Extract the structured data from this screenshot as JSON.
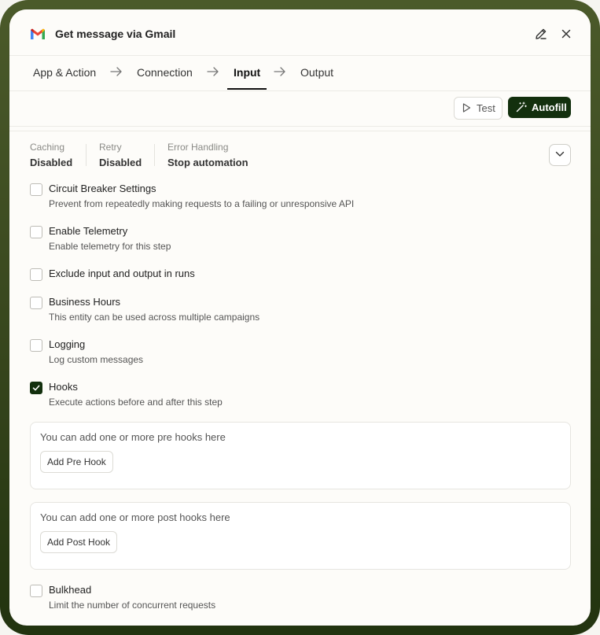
{
  "header": {
    "title": "Get message via Gmail",
    "logo_icon": "gmail-logo",
    "edit_icon": "pencil-icon",
    "close_icon": "close-icon"
  },
  "steps": [
    {
      "label": "App & Action",
      "active": false
    },
    {
      "label": "Connection",
      "active": false
    },
    {
      "label": "Input",
      "active": true
    },
    {
      "label": "Output",
      "active": false
    }
  ],
  "toolbar": {
    "test_label": "Test",
    "autofill_label": "Autofill"
  },
  "summary": {
    "caching_label": "Caching",
    "caching_value": "Disabled",
    "retry_label": "Retry",
    "retry_value": "Disabled",
    "error_label": "Error Handling",
    "error_value": "Stop automation"
  },
  "options": [
    {
      "title": "Circuit Breaker Settings",
      "desc": "Prevent from repeatedly making requests to a failing or unresponsive API",
      "checked": false
    },
    {
      "title": "Enable Telemetry",
      "desc": "Enable telemetry for this step",
      "checked": false
    },
    {
      "title": "Exclude input and output in runs",
      "desc": "",
      "checked": false
    },
    {
      "title": "Business Hours",
      "desc": "This entity can be used across multiple campaigns",
      "checked": false
    },
    {
      "title": "Logging",
      "desc": "Log custom messages",
      "checked": false
    },
    {
      "title": "Hooks",
      "desc": "Execute actions before and after this step",
      "checked": true
    },
    {
      "title": "Bulkhead",
      "desc": "Limit the number of concurrent requests",
      "checked": false
    }
  ],
  "hooks": {
    "pre_text": "You can add one or more pre hooks here",
    "pre_button": "Add Pre Hook",
    "post_text": "You can add one or more post hooks here",
    "post_button": "Add Post Hook"
  },
  "colors": {
    "accent": "#13300e",
    "frame": "#3e4d22"
  }
}
